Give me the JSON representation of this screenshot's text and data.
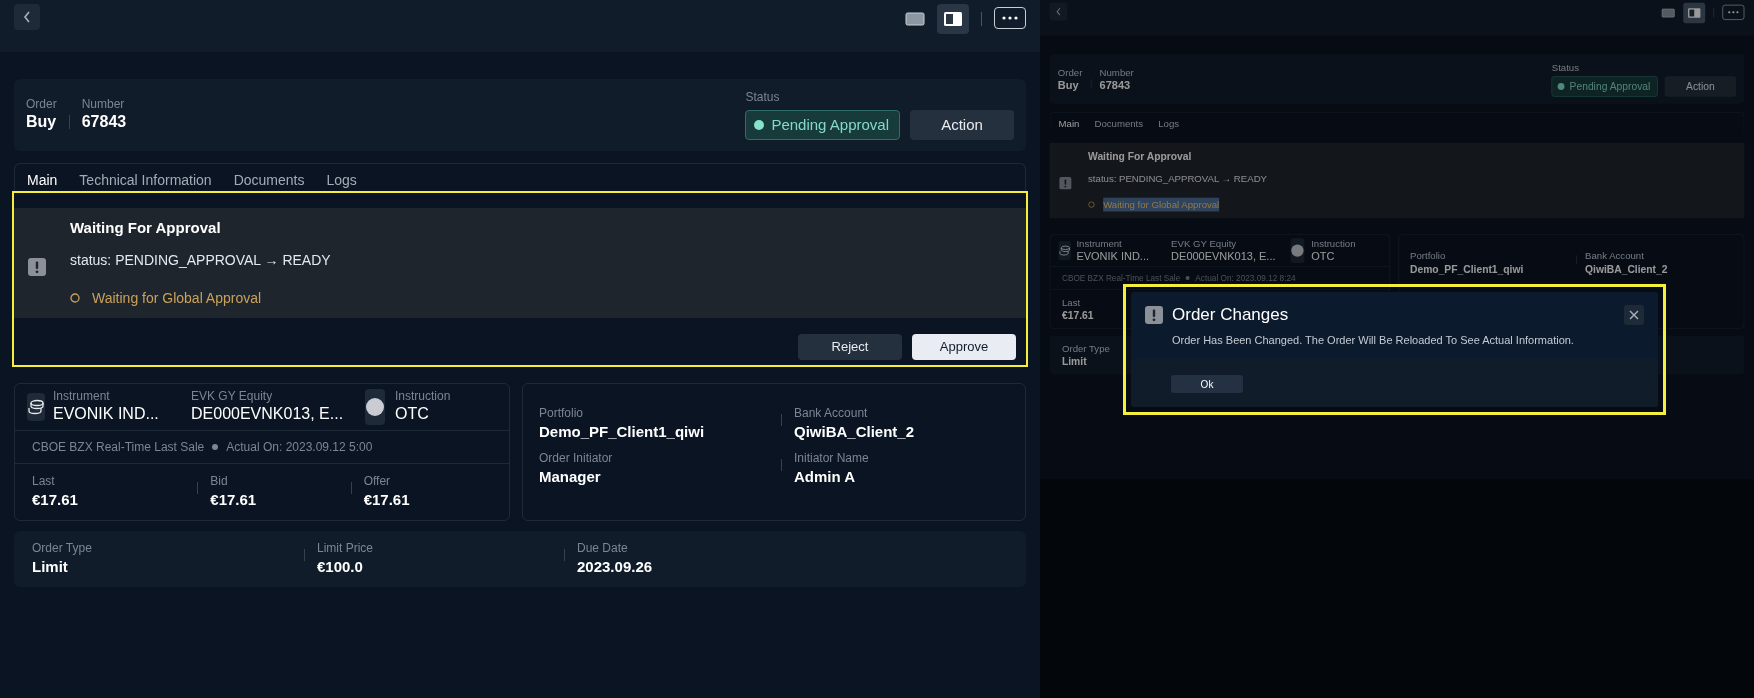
{
  "screens": [
    {
      "toolbar": {
        "views": [
          {
            "selected": false
          },
          {
            "selected": true
          }
        ]
      },
      "order": {
        "fields": [
          {
            "label": "Order",
            "value": "Buy"
          },
          {
            "label": "Number",
            "value": "67843"
          }
        ],
        "status_label": "Status",
        "status": "Pending Approval",
        "action": "Action"
      },
      "tabs": [
        {
          "label": "Main",
          "selected": true
        },
        {
          "label": "Technical Information",
          "selected": false
        },
        {
          "label": "Documents",
          "selected": false
        },
        {
          "label": "Logs",
          "selected": false
        }
      ],
      "approval": {
        "highlighted": true,
        "title": "Waiting For Approval",
        "status_line": "status: PENDING_APPROVAL → READY",
        "hint": "Waiting for Global Approval",
        "hint_selected": false,
        "buttons": [
          "Reject",
          "Approve"
        ]
      },
      "instrument": {
        "fields": [
          {
            "label": "Instrument",
            "value": "EVONIK IND..."
          },
          {
            "label": "EVK GY Equity",
            "value": "DE000EVNK013, E..."
          },
          {
            "label": "Instruction",
            "value": "OTC"
          }
        ],
        "source": "CBOE BZX Real-Time Last Sale",
        "actual": "Actual On: 2023.09.12 5:00",
        "quotes": [
          {
            "label": "Last",
            "value": "€17.61"
          },
          {
            "label": "Bid",
            "value": "€17.61"
          },
          {
            "label": "Offer",
            "value": "€17.61"
          }
        ]
      },
      "accounts": [
        [
          {
            "label": "Portfolio",
            "value": "Demo_PF_Client1_qiwi"
          },
          {
            "label": "Bank Account",
            "value": "QiwiBA_Client_2"
          }
        ],
        [
          {
            "label": "Order Initiator",
            "value": "Manager"
          },
          {
            "label": "Initiator Name",
            "value": "Admin A"
          }
        ]
      ],
      "terms": [
        {
          "label": "Order Type",
          "value": "Limit"
        },
        {
          "label": "Limit Price",
          "value": "€100.0"
        },
        {
          "label": "Due Date",
          "value": "2023.09.26"
        }
      ]
    },
    {
      "toolbar": {
        "views": [
          {
            "selected": false
          },
          {
            "selected": true
          }
        ]
      },
      "order": {
        "fields": [
          {
            "label": "Order",
            "value": "Buy"
          },
          {
            "label": "Number",
            "value": "67843"
          }
        ],
        "status_label": "Status",
        "status": "Pending Approval",
        "action": "Action"
      },
      "tabs": [
        {
          "label": "Main",
          "selected": true
        },
        {
          "label": "Documents",
          "selected": false
        },
        {
          "label": "Logs",
          "selected": false
        }
      ],
      "approval": {
        "highlighted": false,
        "title": "Waiting For Approval",
        "status_line": "status: PENDING_APPROVAL → READY",
        "hint": "Waiting for Global Approval",
        "hint_selected": true
      },
      "instrument": {
        "fields": [
          {
            "label": "Instrument",
            "value": "EVONIK IND..."
          },
          {
            "label": "EVK GY Equity",
            "value": "DE000EVNK013, E..."
          },
          {
            "label": "Instruction",
            "value": "OTC"
          }
        ],
        "source": "CBOE BZX Real-Time Last Sale",
        "actual": "Actual On: 2023.09.12 8:24",
        "quotes": [
          {
            "label": "Last",
            "value": "€17.61"
          }
        ]
      },
      "accounts": [
        [
          {
            "label": "Portfolio",
            "value": "Demo_PF_Client1_qiwi"
          },
          {
            "label": "Bank Account",
            "value": "QiwiBA_Client_2"
          }
        ]
      ],
      "terms": [
        {
          "label": "Order Type",
          "value": "Limit"
        }
      ]
    }
  ],
  "modal": {
    "highlighted": true,
    "title": "Order Changes",
    "message": "Order Has Been Changed. The Order Will Be Reloaded To See Actual Information.",
    "button": "Ok"
  }
}
